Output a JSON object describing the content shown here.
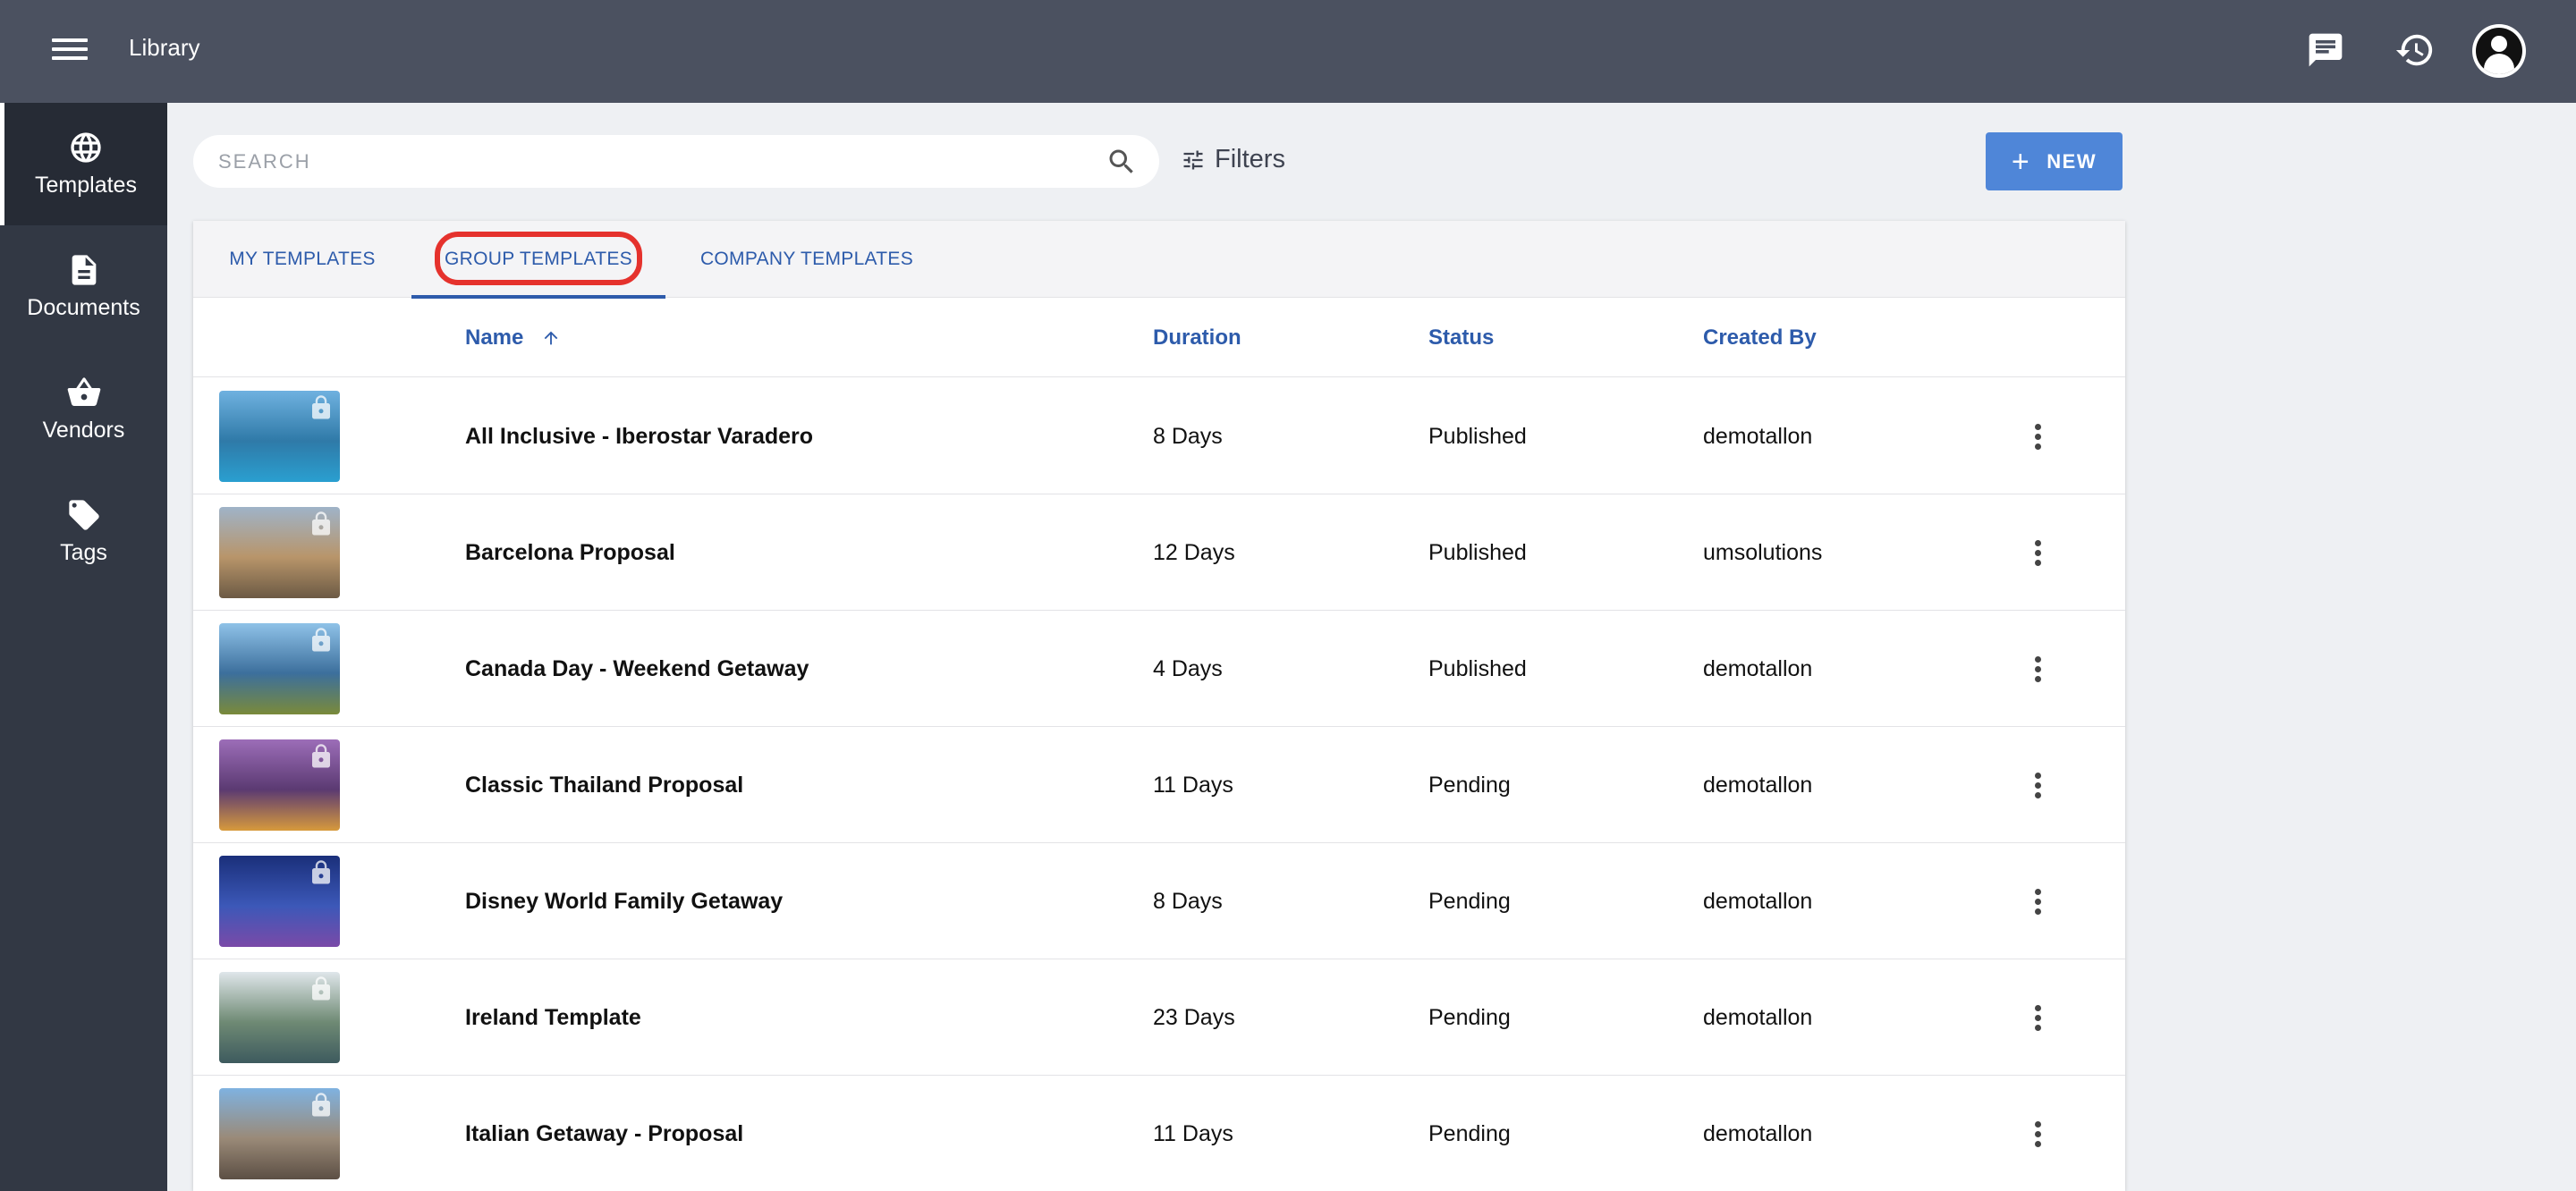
{
  "header": {
    "title": "Library",
    "icons": [
      "menu-icon",
      "chat-icon",
      "history-icon",
      "avatar"
    ]
  },
  "sidebar": {
    "items": [
      {
        "label": "Templates",
        "icon": "globe-icon",
        "active": true
      },
      {
        "label": "Documents",
        "icon": "document-icon",
        "active": false
      },
      {
        "label": "Vendors",
        "icon": "basket-icon",
        "active": false
      },
      {
        "label": "Tags",
        "icon": "tag-icon",
        "active": false
      }
    ]
  },
  "toolbar": {
    "search_placeholder": "SEARCH",
    "filters_label": "Filters",
    "new_label": "NEW"
  },
  "tabs": [
    {
      "label": "MY TEMPLATES",
      "active": false
    },
    {
      "label": "GROUP TEMPLATES",
      "active": true,
      "highlighted": true
    },
    {
      "label": "COMPANY TEMPLATES",
      "active": false
    }
  ],
  "table": {
    "columns": [
      "Name",
      "Duration",
      "Status",
      "Created By"
    ],
    "sort_column": "Name",
    "sort_direction": "ascending",
    "rows": [
      {
        "name": "All Inclusive - Iberostar Varadero",
        "duration": "8 Days",
        "status": "Published",
        "created_by": "demotallon",
        "thumb_colors": [
          "#6fb1e0",
          "#2f7aa8",
          "#2a9fd0"
        ],
        "locked": true
      },
      {
        "name": "Barcelona Proposal",
        "duration": "12 Days",
        "status": "Published",
        "created_by": "umsolutions",
        "thumb_colors": [
          "#9fb3c8",
          "#b8956a",
          "#6c5a44"
        ],
        "locked": true
      },
      {
        "name": "Canada Day - Weekend Getaway",
        "duration": "4 Days",
        "status": "Published",
        "created_by": "demotallon",
        "thumb_colors": [
          "#8fc2e8",
          "#3c6f9c",
          "#7a8a3a"
        ],
        "locked": true
      },
      {
        "name": "Classic Thailand Proposal",
        "duration": "11 Days",
        "status": "Pending",
        "created_by": "demotallon",
        "thumb_colors": [
          "#9c6db8",
          "#5b3a72",
          "#d79a3c"
        ],
        "locked": true
      },
      {
        "name": "Disney World Family Getaway",
        "duration": "8 Days",
        "status": "Pending",
        "created_by": "demotallon",
        "thumb_colors": [
          "#1a2f7a",
          "#3c58b8",
          "#7a4aa8"
        ],
        "locked": true
      },
      {
        "name": "Ireland Template",
        "duration": "23 Days",
        "status": "Pending",
        "created_by": "demotallon",
        "thumb_colors": [
          "#dfe6ea",
          "#6f8a74",
          "#3d5a5e"
        ],
        "locked": true
      },
      {
        "name": "Italian Getaway - Proposal",
        "duration": "11 Days",
        "status": "Pending",
        "created_by": "demotallon",
        "thumb_colors": [
          "#7fb2e0",
          "#9a8a78",
          "#5c4f44"
        ],
        "locked": true
      }
    ]
  }
}
